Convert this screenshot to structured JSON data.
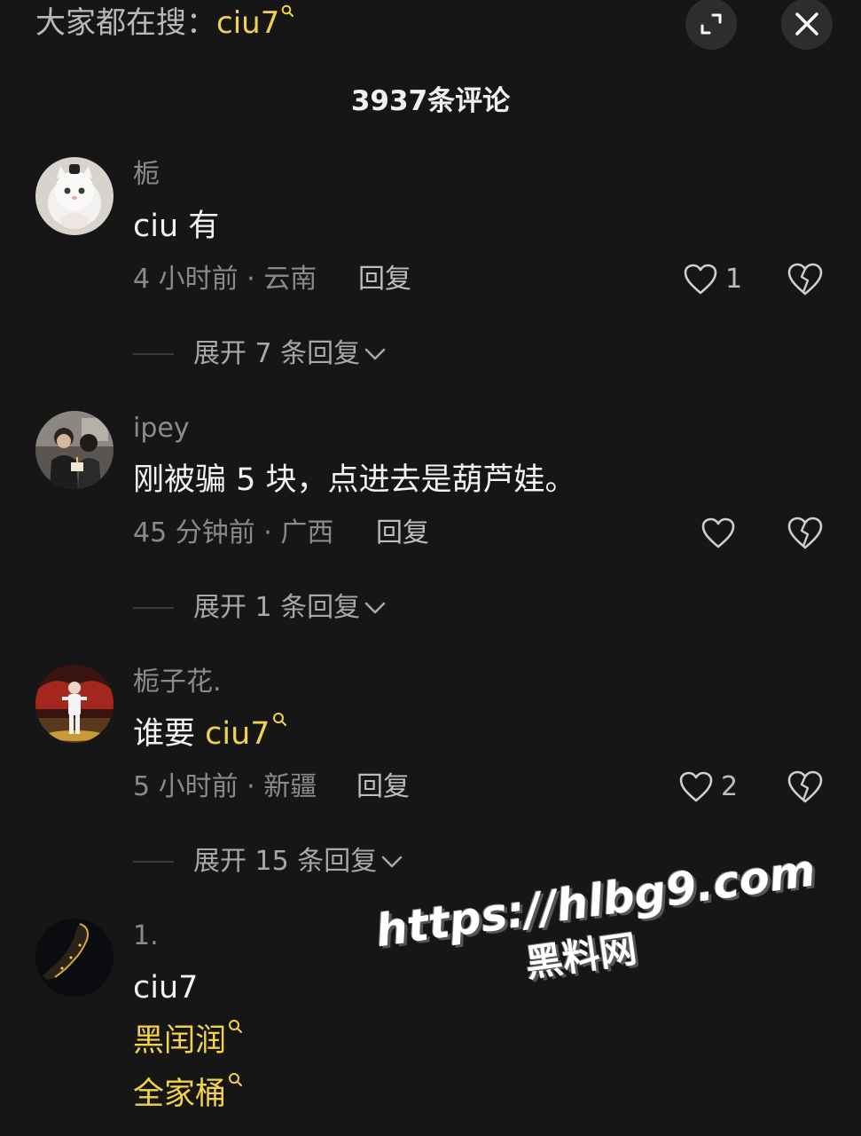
{
  "header": {
    "search_prefix": "大家都在搜：",
    "search_keyword": "ciu7",
    "comment_count": "3937条评论"
  },
  "comments": [
    {
      "username": "栀",
      "text": "ciu 有",
      "meta": "4 小时前 · 云南",
      "reply_label": "回复",
      "likes": "1",
      "expand_label": "展开 7 条回复"
    },
    {
      "username": "ipey",
      "text": "刚被骗 5 块，点进去是葫芦娃。",
      "meta": "45 分钟前 · 广西",
      "reply_label": "回复",
      "likes": "",
      "expand_label": "展开 1 条回复"
    },
    {
      "username": "栀子花.",
      "text_prefix": "谁要 ",
      "text_keyword": "ciu7",
      "meta": "5 小时前 · 新疆",
      "reply_label": "回复",
      "likes": "2",
      "expand_label": "展开 15 条回复"
    },
    {
      "username": "1.",
      "text": "ciu7",
      "keyword_links": [
        "黑闰润",
        "全家桶"
      ]
    }
  ],
  "watermark": {
    "url": "https://hlbg9.com",
    "site": "黑料网"
  },
  "colors": {
    "background": "#161616",
    "keyword": "#f2d24b",
    "secondary_text": "#8a8a8a"
  },
  "icons": {
    "expand": "expand-icon",
    "close": "close-icon",
    "like": "heart-icon",
    "dislike": "broken-heart-icon",
    "chevron": "chevron-down-icon",
    "search": "search-icon"
  }
}
